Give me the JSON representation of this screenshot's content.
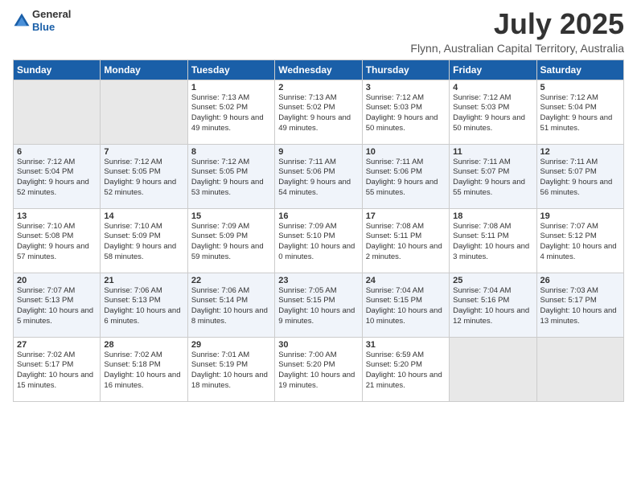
{
  "logo": {
    "general": "General",
    "blue": "Blue"
  },
  "header": {
    "title": "July 2025",
    "subtitle": "Flynn, Australian Capital Territory, Australia"
  },
  "days_of_week": [
    "Sunday",
    "Monday",
    "Tuesday",
    "Wednesday",
    "Thursday",
    "Friday",
    "Saturday"
  ],
  "weeks": [
    [
      {
        "num": "",
        "empty": true
      },
      {
        "num": "",
        "empty": true
      },
      {
        "num": "1",
        "sunrise": "7:13 AM",
        "sunset": "5:02 PM",
        "daylight": "9 hours and 49 minutes."
      },
      {
        "num": "2",
        "sunrise": "7:13 AM",
        "sunset": "5:02 PM",
        "daylight": "9 hours and 49 minutes."
      },
      {
        "num": "3",
        "sunrise": "7:12 AM",
        "sunset": "5:03 PM",
        "daylight": "9 hours and 50 minutes."
      },
      {
        "num": "4",
        "sunrise": "7:12 AM",
        "sunset": "5:03 PM",
        "daylight": "9 hours and 50 minutes."
      },
      {
        "num": "5",
        "sunrise": "7:12 AM",
        "sunset": "5:04 PM",
        "daylight": "9 hours and 51 minutes."
      }
    ],
    [
      {
        "num": "6",
        "sunrise": "7:12 AM",
        "sunset": "5:04 PM",
        "daylight": "9 hours and 52 minutes."
      },
      {
        "num": "7",
        "sunrise": "7:12 AM",
        "sunset": "5:05 PM",
        "daylight": "9 hours and 52 minutes."
      },
      {
        "num": "8",
        "sunrise": "7:12 AM",
        "sunset": "5:05 PM",
        "daylight": "9 hours and 53 minutes."
      },
      {
        "num": "9",
        "sunrise": "7:11 AM",
        "sunset": "5:06 PM",
        "daylight": "9 hours and 54 minutes."
      },
      {
        "num": "10",
        "sunrise": "7:11 AM",
        "sunset": "5:06 PM",
        "daylight": "9 hours and 55 minutes."
      },
      {
        "num": "11",
        "sunrise": "7:11 AM",
        "sunset": "5:07 PM",
        "daylight": "9 hours and 55 minutes."
      },
      {
        "num": "12",
        "sunrise": "7:11 AM",
        "sunset": "5:07 PM",
        "daylight": "9 hours and 56 minutes."
      }
    ],
    [
      {
        "num": "13",
        "sunrise": "7:10 AM",
        "sunset": "5:08 PM",
        "daylight": "9 hours and 57 minutes."
      },
      {
        "num": "14",
        "sunrise": "7:10 AM",
        "sunset": "5:09 PM",
        "daylight": "9 hours and 58 minutes."
      },
      {
        "num": "15",
        "sunrise": "7:09 AM",
        "sunset": "5:09 PM",
        "daylight": "9 hours and 59 minutes."
      },
      {
        "num": "16",
        "sunrise": "7:09 AM",
        "sunset": "5:10 PM",
        "daylight": "10 hours and 0 minutes."
      },
      {
        "num": "17",
        "sunrise": "7:08 AM",
        "sunset": "5:11 PM",
        "daylight": "10 hours and 2 minutes."
      },
      {
        "num": "18",
        "sunrise": "7:08 AM",
        "sunset": "5:11 PM",
        "daylight": "10 hours and 3 minutes."
      },
      {
        "num": "19",
        "sunrise": "7:07 AM",
        "sunset": "5:12 PM",
        "daylight": "10 hours and 4 minutes."
      }
    ],
    [
      {
        "num": "20",
        "sunrise": "7:07 AM",
        "sunset": "5:13 PM",
        "daylight": "10 hours and 5 minutes."
      },
      {
        "num": "21",
        "sunrise": "7:06 AM",
        "sunset": "5:13 PM",
        "daylight": "10 hours and 6 minutes."
      },
      {
        "num": "22",
        "sunrise": "7:06 AM",
        "sunset": "5:14 PM",
        "daylight": "10 hours and 8 minutes."
      },
      {
        "num": "23",
        "sunrise": "7:05 AM",
        "sunset": "5:15 PM",
        "daylight": "10 hours and 9 minutes."
      },
      {
        "num": "24",
        "sunrise": "7:04 AM",
        "sunset": "5:15 PM",
        "daylight": "10 hours and 10 minutes."
      },
      {
        "num": "25",
        "sunrise": "7:04 AM",
        "sunset": "5:16 PM",
        "daylight": "10 hours and 12 minutes."
      },
      {
        "num": "26",
        "sunrise": "7:03 AM",
        "sunset": "5:17 PM",
        "daylight": "10 hours and 13 minutes."
      }
    ],
    [
      {
        "num": "27",
        "sunrise": "7:02 AM",
        "sunset": "5:17 PM",
        "daylight": "10 hours and 15 minutes."
      },
      {
        "num": "28",
        "sunrise": "7:02 AM",
        "sunset": "5:18 PM",
        "daylight": "10 hours and 16 minutes."
      },
      {
        "num": "29",
        "sunrise": "7:01 AM",
        "sunset": "5:19 PM",
        "daylight": "10 hours and 18 minutes."
      },
      {
        "num": "30",
        "sunrise": "7:00 AM",
        "sunset": "5:20 PM",
        "daylight": "10 hours and 19 minutes."
      },
      {
        "num": "31",
        "sunrise": "6:59 AM",
        "sunset": "5:20 PM",
        "daylight": "10 hours and 21 minutes."
      },
      {
        "num": "",
        "empty": true
      },
      {
        "num": "",
        "empty": true
      }
    ]
  ]
}
